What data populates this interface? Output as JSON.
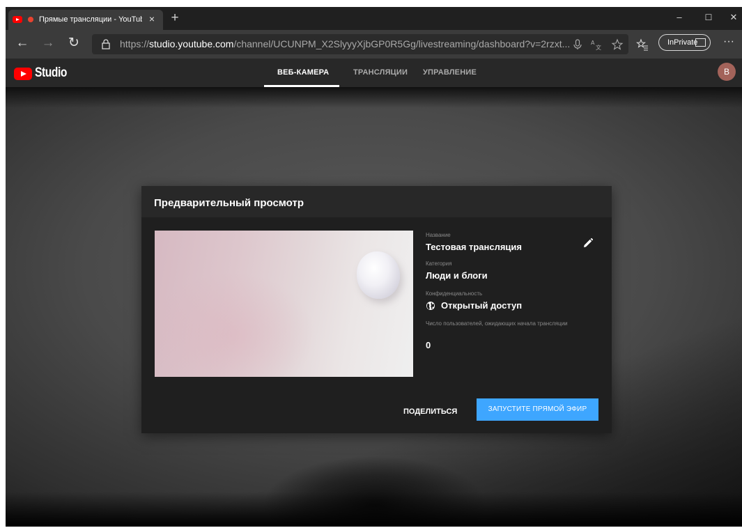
{
  "browser": {
    "tab_title": "Прямые трансляции - YouTube",
    "tab_close": "×",
    "new_tab": "+",
    "window_controls": {
      "minimize": "–",
      "maximize": "☐",
      "close": "✕"
    },
    "nav": {
      "back": "←",
      "forward": "→",
      "refresh": "↻"
    },
    "url_scheme": "https://",
    "url_host": "studio.youtube.com",
    "url_path": "/channel/UCUNPM_X2SlyyyXjbGP0R5Gg/livestreaming/dashboard?v=2rzxt...",
    "inprivate_label": "InPrivate",
    "more_label": "···"
  },
  "studio": {
    "logo_text": "Studio",
    "tabs": [
      {
        "label": "ВЕБ-КАМЕРА",
        "active": true
      },
      {
        "label": "ТРАНСЛЯЦИИ",
        "active": false
      },
      {
        "label": "УПРАВЛЕНИЕ",
        "active": false
      }
    ],
    "avatar_letter": "В"
  },
  "dialog": {
    "title": "Предварительный просмотр",
    "fields": {
      "name_label": "Название",
      "name_value": "Тестовая трансляция",
      "category_label": "Категория",
      "category_value": "Люди и блоги",
      "privacy_label": "Конфиденциальность",
      "privacy_value": "Открытый доступ",
      "waiting_label": "Число пользователей, ожидающих начала трансляции",
      "waiting_value": "0"
    },
    "share_label": "ПОДЕЛИТЬСЯ",
    "go_live_label": "ЗАПУСТИТЕ ПРЯМОЙ ЭФИР"
  },
  "colors": {
    "accent_blue": "#3ea6ff",
    "youtube_red": "#ff0000",
    "avatar_bg": "#a3635a"
  },
  "icons": [
    "back-icon",
    "forward-icon",
    "refresh-icon",
    "lock-icon",
    "microphone-icon",
    "translate-icon",
    "star-icon",
    "favorites-icon",
    "edit-icon",
    "globe-icon"
  ]
}
